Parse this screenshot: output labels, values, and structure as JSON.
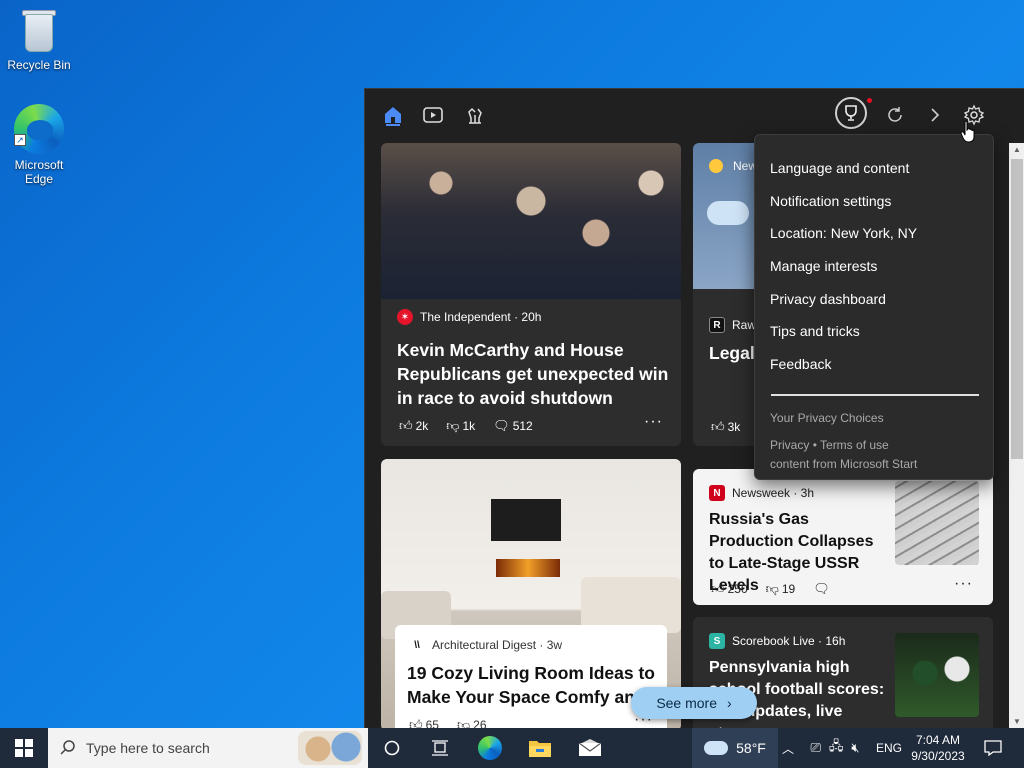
{
  "desktop": {
    "icons": [
      {
        "label": "Recycle Bin"
      },
      {
        "label": "Microsoft Edge"
      }
    ]
  },
  "widgets": {
    "cards": {
      "main": {
        "source": "The Independent · 20h",
        "headline": "Kevin McCarthy and House Republicans get unexpected win in race to avoid shutdown",
        "likes": "2k",
        "dislikes": "1k",
        "comments": "512"
      },
      "legal": {
        "weather_label": "New",
        "source": "Raw",
        "headline": "Legal s for Tru preside",
        "likes": "3k"
      },
      "living": {
        "source": "Architectural Digest · 3w",
        "headline": "19 Cozy Living Room Ideas to Make Your Space Comfy an",
        "likes": "65",
        "dislikes": "26"
      },
      "russia": {
        "source": "Newsweek · 3h",
        "headline": "Russia's Gas Production Collapses to Late-Stage USSR Levels",
        "likes": "250",
        "dislikes": "19"
      },
      "score": {
        "source": "Scorebook Live · 16h",
        "headline": "Pennsylvania high school football scores: Live updates, live streams ..."
      }
    },
    "see_more": "See more"
  },
  "settings_menu": {
    "items": [
      "Language and content",
      "Notification settings",
      "Location: New York, NY",
      "Manage interests",
      "Privacy dashboard",
      "Tips and tricks",
      "Feedback"
    ],
    "privacy_choices": "Your Privacy Choices",
    "privacy": "Privacy",
    "bullet": "•",
    "terms": "Terms of use",
    "content_from": "content from Microsoft Start"
  },
  "taskbar": {
    "search_placeholder": "Type here to search",
    "weather": "58°F",
    "language": "ENG",
    "time": "7:04 AM",
    "date": "9/30/2023"
  },
  "colors": {
    "accent": "#4c8bf5",
    "independent_red": "#e5142b",
    "newsweek_red": "#d0021b"
  }
}
